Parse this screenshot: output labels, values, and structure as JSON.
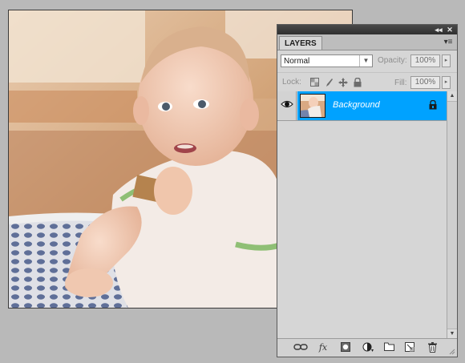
{
  "canvas": {
    "image": "baby-photo"
  },
  "panel": {
    "tab_label": "LAYERS",
    "collapse_icon": "double-chevron-icon",
    "close_glyph": "✕",
    "menu_icon": "panel-menu-icon",
    "blend_mode": "Normal",
    "opacity_label": "Opacity:",
    "opacity_value": "100%",
    "lock_label": "Lock:",
    "fill_label": "Fill:",
    "fill_value": "100%",
    "lock_icons": [
      "lock-transparent-icon",
      "lock-image-icon",
      "lock-position-icon",
      "lock-all-icon"
    ],
    "layers": [
      {
        "name": "Background",
        "visible": true,
        "locked": true,
        "selected": true
      }
    ],
    "bottom_icons": [
      "link-layers-icon",
      "fx-icon",
      "add-mask-icon",
      "adjustment-layer-icon",
      "new-group-icon",
      "new-layer-icon",
      "delete-layer-icon"
    ],
    "fx_label": "fx"
  },
  "colors": {
    "selection": "#00a2ff",
    "panel_bg": "#d6d6d6",
    "workspace": "#b9b9b9"
  }
}
